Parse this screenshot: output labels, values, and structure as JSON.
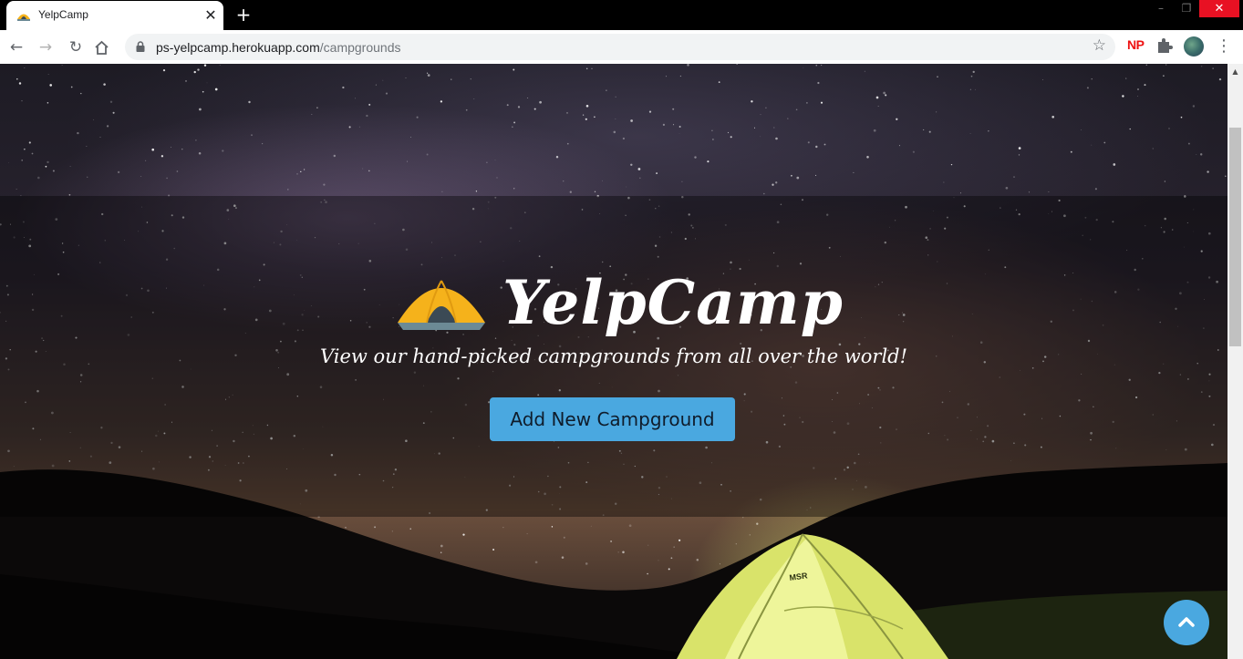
{
  "browser": {
    "tab_title": "YelpCamp",
    "new_tab_symbol": "+",
    "url_host": "ps-yelpcamp.herokuapp.com",
    "url_path": "/campgrounds",
    "extension_np_label": "NP",
    "icons": [
      "back-arrow-icon",
      "forward-arrow-icon",
      "reload-icon",
      "home-icon",
      "lock-icon",
      "star-icon",
      "puzzle-icon",
      "menu-dots-icon"
    ]
  },
  "hero": {
    "title": "YelpCamp",
    "subtitle": "View our hand-picked campgrounds from all over the world!",
    "cta_label": "Add New Campground",
    "logo_icon": "tent-icon"
  },
  "colors": {
    "accent": "#4aa8e0",
    "close_red": "#e81123",
    "tent_yellow": "#f5b21b"
  },
  "scroll_to_top_icon": "chevron-up-icon"
}
